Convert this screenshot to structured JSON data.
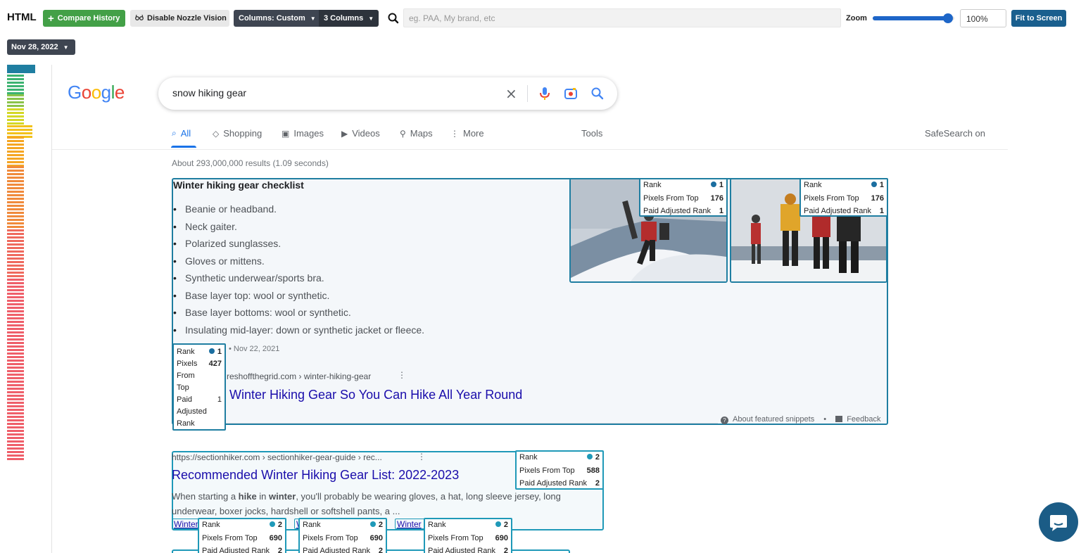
{
  "toolbar": {
    "title": "HTML",
    "compare_history": "Compare History",
    "disable_vision": "Disable Nozzle Vision",
    "columns": "Columns: Custom",
    "column_count": "3 Columns",
    "search_placeholder": "eg. PAA, My brand, etc",
    "zoom_label": "Zoom",
    "zoom_value": "100%",
    "zoom_level": 0.92,
    "fit_to_screen": "Fit to Screen",
    "date": "Nov 28, 2022"
  },
  "google": {
    "logo": [
      "G",
      "o",
      "o",
      "g",
      "l",
      "e"
    ],
    "logo_colors": [
      "#4285f4",
      "#ea4335",
      "#fbbc05",
      "#4285f4",
      "#34a853",
      "#ea4335"
    ],
    "query": "snow hiking gear",
    "clear_icon": "×",
    "tabs": [
      {
        "icon": "search-icon",
        "glyph": "⌕",
        "label": "All"
      },
      {
        "icon": "tag-icon",
        "glyph": "◇",
        "label": "Shopping"
      },
      {
        "icon": "image-icon",
        "glyph": "▣",
        "label": "Images"
      },
      {
        "icon": "video-icon",
        "glyph": "▶",
        "label": "Videos"
      },
      {
        "icon": "map-pin-icon",
        "glyph": "⚲",
        "label": "Maps"
      },
      {
        "icon": "more-icon",
        "glyph": "⋮",
        "label": "More"
      }
    ],
    "tools": "Tools",
    "safesearch": "SafeSearch on",
    "stats": "About 293,000,000 results (1.09 seconds)"
  },
  "snippet": {
    "title": "Winter hiking gear checklist",
    "items": [
      "Beanie or headband.",
      "Neck gaiter.",
      "Polarized sunglasses.",
      "Gloves or mittens.",
      "Synthetic underwear/sports bra.",
      "Base layer top: wool or synthetic.",
      "Base layer bottoms: wool or synthetic.",
      "Insulating mid-layer: down or synthetic jacket or fleece."
    ],
    "date": "• Nov 22, 2021",
    "url": "reshoffthegrid.com › winter-hiking-gear",
    "dots": "⋮",
    "link": "Winter Hiking Gear So You Can Hike All Year Round",
    "about": "About featured snippets",
    "sep": "•",
    "feedback": "Feedback"
  },
  "rank_labels": {
    "rank": "Rank",
    "pixels": "Pixels From Top",
    "paid": "Paid Adjusted Rank"
  },
  "rank_tall_labels": {
    "rank": "Rank",
    "pixels": "Pixels From Top",
    "paid": "Paid Adjusted Rank"
  },
  "rank_tips": [
    {
      "rank": "1",
      "pixels": "176",
      "paid": "1",
      "dot": "#1b6ea0"
    },
    {
      "rank": "1",
      "pixels": "176",
      "paid": "1",
      "dot": "#1b6ea0"
    },
    {
      "rank": "1",
      "pixels": "427",
      "paid": "1",
      "dot": "#1b6ea0"
    },
    {
      "rank": "2",
      "pixels": "588",
      "paid": "2",
      "dot": "#1f99b8"
    },
    {
      "rank": "2",
      "pixels": "690",
      "paid": "2",
      "dot": "#1f99b8"
    },
    {
      "rank": "2",
      "pixels": "690",
      "paid": "2",
      "dot": "#1f99b8"
    },
    {
      "rank": "2",
      "pixels": "690",
      "paid": "2",
      "dot": "#1f99b8"
    }
  ],
  "result2": {
    "url": "https://sectionhiker.com › sectionhiker-gear-guide › rec...",
    "dots": "⋮",
    "title": "Recommended Winter Hiking Gear List: 2022-2023",
    "desc_1": "When starting a ",
    "desc_b1": "hike",
    "desc_2": " in ",
    "desc_b2": "winter",
    "desc_3": ", you'll probably be wearing gloves, a hat, long sleeve jersey, long underwear, boxer jocks, hardshell or softshell pants, a ...",
    "sitelinks": [
      "Winter",
      "W",
      "Winter"
    ]
  },
  "minimap": {
    "colors": [
      "#1f7ea1",
      "#1fa3a8",
      "#3cb371",
      "#8bc34a",
      "#d4d827",
      "#f2c21b",
      "#f5a623",
      "#f08a3c",
      "#ef6a5e",
      "#ef5f6a"
    ]
  },
  "colors": {
    "accent": "#1f7ea1",
    "link": "#1a0dab",
    "green": "#43a047"
  }
}
